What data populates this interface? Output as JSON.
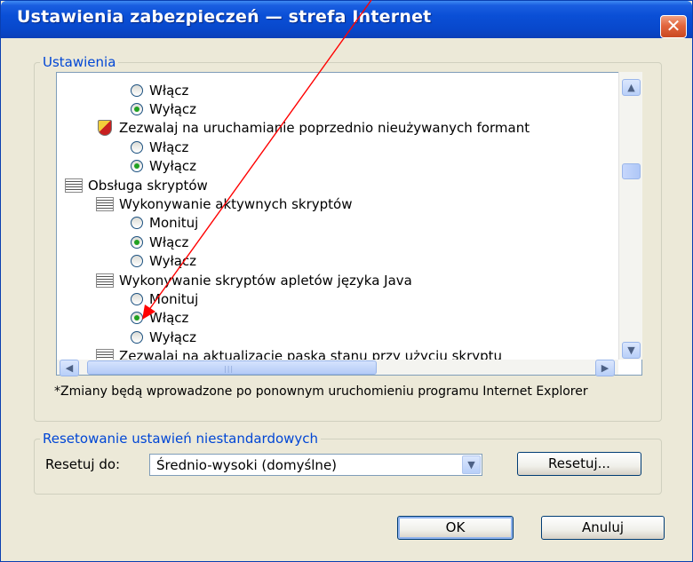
{
  "window": {
    "title": "Ustawienia zabezpieczeń — strefa Internet",
    "close_glyph": "✕"
  },
  "settings_group": {
    "legend": "Ustawienia",
    "tree": [
      {
        "kind": "radio",
        "label": "Włącz",
        "checked": false
      },
      {
        "kind": "radio",
        "label": "Wyłącz",
        "checked": true
      },
      {
        "kind": "setting",
        "label": "Zezwalaj na uruchamianie poprzednio nieużywanych formant",
        "icon": "shield-icon"
      },
      {
        "kind": "radio",
        "label": "Włącz",
        "checked": false
      },
      {
        "kind": "radio",
        "label": "Wyłącz",
        "checked": true
      },
      {
        "kind": "category",
        "label": "Obsługa skryptów",
        "icon": "settings-category-icon"
      },
      {
        "kind": "category",
        "label": "Wykonywanie aktywnych skryptów",
        "icon": "settings-category-icon"
      },
      {
        "kind": "radio",
        "label": "Monituj",
        "checked": false
      },
      {
        "kind": "radio",
        "label": "Włącz",
        "checked": true
      },
      {
        "kind": "radio",
        "label": "Wyłącz",
        "checked": false
      },
      {
        "kind": "category",
        "label": "Wykonywanie skryptów apletów języka Java",
        "icon": "settings-category-icon"
      },
      {
        "kind": "radio",
        "label": "Monituj",
        "checked": false
      },
      {
        "kind": "radio",
        "label": "Włącz",
        "checked": true
      },
      {
        "kind": "radio",
        "label": "Wyłącz",
        "checked": false
      },
      {
        "kind": "category",
        "label": "Zezwalaj na aktualizacje paska stanu przy użyciu skryptu",
        "icon": "settings-category-icon"
      }
    ],
    "note": "*Zmiany będą wprowadzone po ponownym uruchomieniu programu Internet Explorer"
  },
  "reset_group": {
    "legend": "Resetowanie ustawień niestandardowych",
    "reset_to_label": "Resetuj do:",
    "selected_level": "Średnio-wysoki (domyślne)",
    "reset_button": "Resetuj..."
  },
  "buttons": {
    "ok": "OK",
    "cancel": "Anuluj"
  },
  "colors": {
    "title_blue": "#0a4fd6",
    "annotation_arrow": "#ff0000",
    "selected_radio": "#21a121"
  }
}
